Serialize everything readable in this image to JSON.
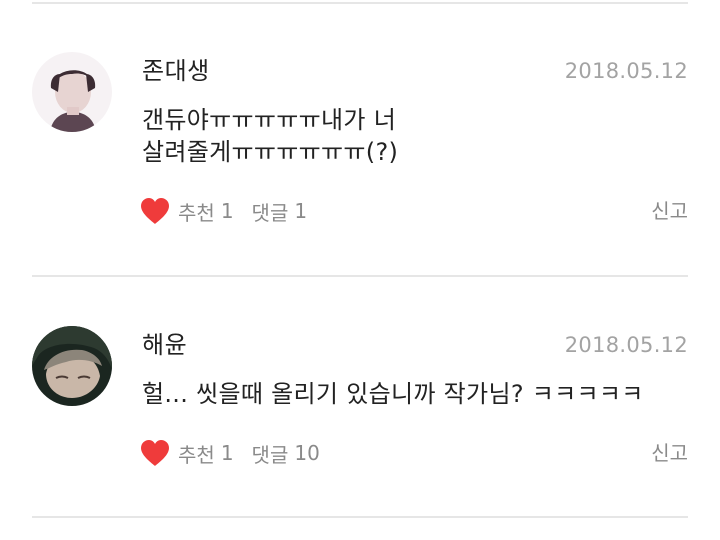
{
  "comments": [
    {
      "author": "존대생",
      "date": "2018.05.12",
      "text": "갠듀야ㅠㅠㅠㅠㅠ내가 너\n살려줄게ㅠㅠㅠㅠㅠㅠ(?)",
      "like_label": "추천",
      "like_count": "1",
      "reply_label": "댓글",
      "reply_count": "1",
      "report_label": "신고"
    },
    {
      "author": "해윤",
      "date": "2018.05.12",
      "text": "헐... 씻을때 올리기 있습니까 작가님? ㅋㅋㅋㅋㅋ",
      "like_label": "추천",
      "like_count": "1",
      "reply_label": "댓글",
      "reply_count": "10",
      "report_label": "신고"
    }
  ],
  "icons": {
    "like": "heart-icon",
    "avatar": "avatar"
  },
  "colors": {
    "heart": "#ef3b3b",
    "meta_text": "#8a8a8a",
    "date_text": "#a3a3a3",
    "divider": "#e6e6e6"
  }
}
